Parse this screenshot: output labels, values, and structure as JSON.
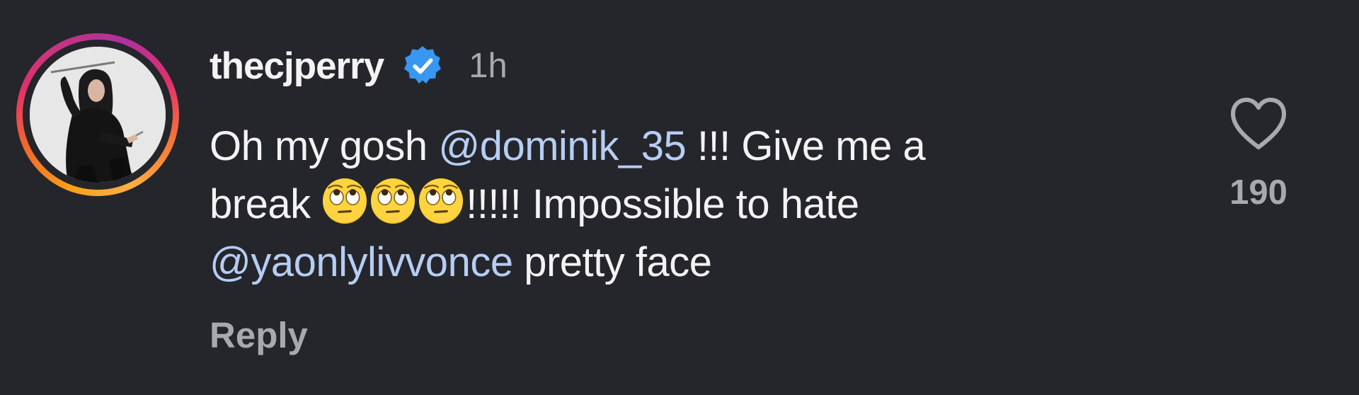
{
  "comment": {
    "username": "thecjperry",
    "timestamp": "1h",
    "text": {
      "line1_prefix": "Oh my gosh ",
      "mention1": "@dominik_35",
      "line1_suffix": " !!! Give me a",
      "line2_prefix": "break ",
      "emoji": "🙄",
      "line2_suffix": "!!!!! Impossible to hate",
      "mention2": "@yaonlylivvonce",
      "line3_suffix": " pretty face"
    },
    "reply_label": "Reply",
    "like_count": "190"
  },
  "icons": {
    "verified": "verified-badge-icon",
    "like": "heart-outline-icon",
    "emoji": "face-with-rolling-eyes-emoji"
  },
  "colors": {
    "background": "#25262b",
    "text_primary": "#f3f3f3",
    "text_secondary": "#a8a9ad",
    "mention": "#b6cdf4",
    "verified_blue": "#3897f0"
  }
}
